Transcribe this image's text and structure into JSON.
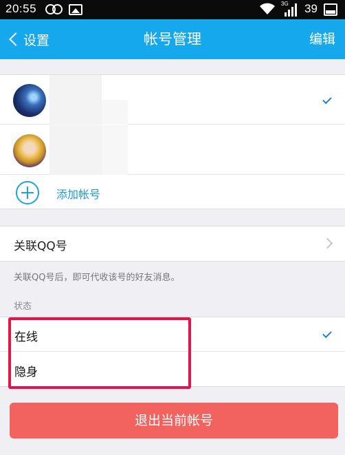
{
  "status_bar": {
    "time": "20:55",
    "network": "3G",
    "battery": "39",
    "battery_level": 0.39,
    "icons": [
      "circles-icon",
      "image-icon",
      "wifi-icon",
      "signal-icon",
      "battery-icon"
    ]
  },
  "nav": {
    "back_label": "设置",
    "title": "帐号管理",
    "edit_label": "编辑"
  },
  "accounts": {
    "items": [
      {
        "avatar": "avatar-blue-night",
        "selected": true
      },
      {
        "avatar": "avatar-girl-cartoon",
        "selected": false
      }
    ],
    "add_label": "添加帐号"
  },
  "link_qq": {
    "label": "关联QQ号",
    "hint": "关联QQ号后，即可代收该号的好友消息。"
  },
  "presence": {
    "header": "状态",
    "options": [
      {
        "label": "在线",
        "selected": true
      },
      {
        "label": "隐身",
        "selected": false
      }
    ]
  },
  "logout_label": "退出当前帐号",
  "colors": {
    "accent": "#15a8ec",
    "logout": "#f2635f",
    "highlight": "#e8124a",
    "check": "#1d82d4"
  }
}
